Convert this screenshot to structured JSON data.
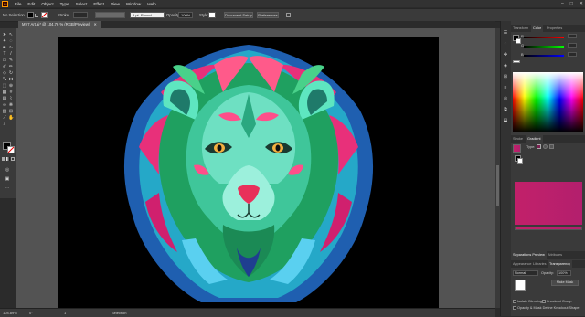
{
  "app": {
    "logo_text": "Ai"
  },
  "menubar": {
    "items": [
      "File",
      "Edit",
      "Object",
      "Type",
      "Select",
      "Effect",
      "View",
      "Window",
      "Help"
    ],
    "window_controls": [
      "–",
      "□",
      "✕"
    ]
  },
  "controlbar": {
    "selection_label": "No Selection",
    "stroke_label": "Stroke:",
    "brush_value": "5 pt. Round",
    "opacity_label": "Opacity:",
    "opacity_value": "100%",
    "style_label": "Style:",
    "document_setup_label": "Document Setup",
    "preferences_label": "Preferences"
  },
  "document": {
    "tab_title": "MY7 Art.ai* @ 104.76 % (RGB/Preview)",
    "close_icon": "close-icon"
  },
  "statusbar": {
    "zoom": "104.89%",
    "angle": "0°",
    "page": "1",
    "tool_name": "Selection"
  },
  "panels": {
    "top_tabs": [
      "Transform",
      "Color",
      "Properties"
    ],
    "active_top_tab": "Color",
    "mid_tabs": [
      "Stroke",
      "Gradient"
    ],
    "gradient_type_label": "Type:",
    "bottom_tabs1": [
      "Separations Preview",
      "Attributes"
    ],
    "bottom_tabs2": [
      "Appearance",
      "Libraries",
      "Transparency"
    ],
    "blend_mode": "Normal",
    "opacity_label": "Opacity:",
    "opacity_value": "100%",
    "make_mask_label": "Make Mask",
    "isolate_blending_label": "Isolate Blending",
    "knockout_group_label": "Knockout Group",
    "opacity_mask_label": "Opacity & Mask Define Knockout Shape"
  },
  "colors": {
    "accent": "#ff9a00",
    "gradient_start": "#c2206a",
    "gradient_end": "#b31f6d",
    "artboard": "#000000"
  }
}
